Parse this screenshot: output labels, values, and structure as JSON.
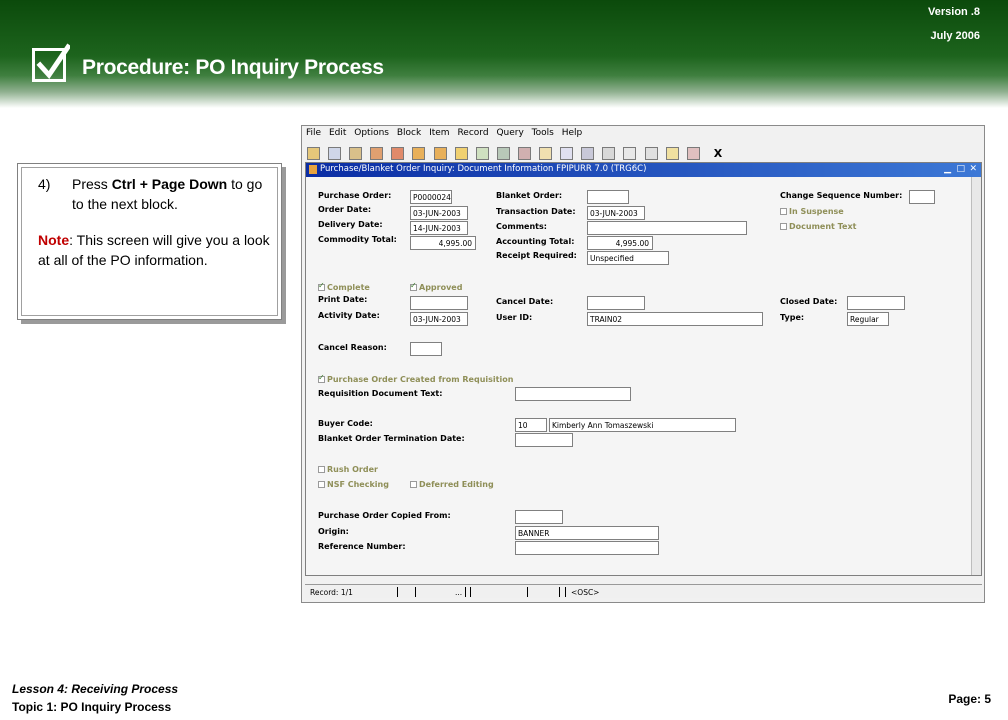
{
  "header": {
    "version": "Version .8",
    "date": "July 2006",
    "title": "Procedure: PO Inquiry Process"
  },
  "instructions": {
    "step_number": "4)",
    "step_pre": "Press ",
    "step_keys": "Ctrl + Page Down",
    "step_post": " to go to the next block.",
    "note_label": "Note",
    "note_text": ":  This screen will give you a look at all of the PO information."
  },
  "app": {
    "menu": [
      "File",
      "Edit",
      "Options",
      "Block",
      "Item",
      "Record",
      "Query",
      "Tools",
      "Help"
    ],
    "toolbar_close": "X",
    "form_title": "Purchase/Blanket Order Inquiry: Document Information  FPIPURR  7.0  (TRG6C)",
    "labels": {
      "purchase_order": "Purchase Order:",
      "order_date": "Order Date:",
      "delivery_date": "Delivery Date:",
      "commodity_total": "Commodity Total:",
      "blanket_order": "Blanket Order:",
      "transaction_date": "Transaction Date:",
      "comments": "Comments:",
      "accounting_total": "Accounting Total:",
      "receipt_required": "Receipt Required:",
      "change_sequence_number": "Change Sequence Number:",
      "print_date": "Print Date:",
      "activity_date": "Activity Date:",
      "cancel_date": "Cancel Date:",
      "user_id": "User ID:",
      "closed_date": "Closed Date:",
      "type": "Type:",
      "cancel_reason": "Cancel Reason:",
      "requisition_document_text": "Requisition Document Text:",
      "buyer_code": "Buyer Code:",
      "blanket_order_termination_date": "Blanket Order Termination Date:",
      "po_copied_from": "Purchase Order Copied From:",
      "origin": "Origin:",
      "reference_number": "Reference Number:"
    },
    "checkboxes": {
      "in_suspense": "In Suspense",
      "document_text": "Document Text",
      "complete": "Complete",
      "approved": "Approved",
      "po_created_from_requisition": "Purchase Order Created from Requisition",
      "rush_order": "Rush Order",
      "nsf_checking": "NSF Checking",
      "deferred_editing": "Deferred Editing"
    },
    "values": {
      "purchase_order": "P0000024",
      "order_date": "03-JUN-2003",
      "delivery_date": "14-JUN-2003",
      "commodity_total": "4,995.00",
      "transaction_date": "03-JUN-2003",
      "accounting_total": "4,995.00",
      "receipt_required": "Unspecified",
      "activity_date": "03-JUN-2003",
      "user_id": "TRAIN02",
      "type": "Regular",
      "buyer_code": "10",
      "buyer_name": "Kimberly  Ann  Tomaszewski",
      "origin": "BANNER"
    },
    "status": {
      "record": "Record: 1/1",
      "ellipsis": "...",
      "osc": "<OSC>"
    }
  },
  "footer": {
    "lesson": "Lesson 4: Receiving Process",
    "topic": "Topic 1: PO Inquiry Process",
    "page": "Page: 5"
  }
}
